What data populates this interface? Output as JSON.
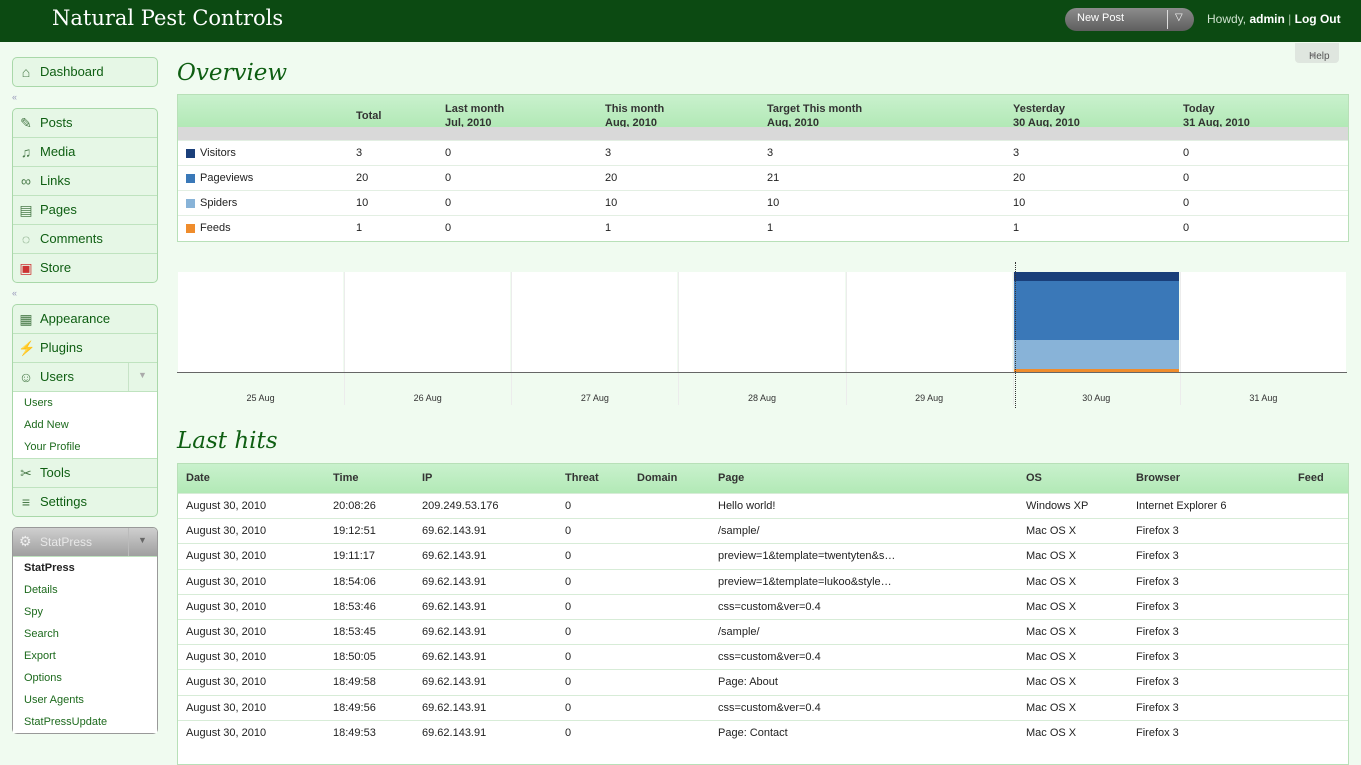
{
  "header": {
    "site_title": "Natural Pest Controls",
    "new_post": "New Post",
    "howdy_prefix": "Howdy,",
    "user": "admin",
    "logout": "Log Out",
    "help": "Help"
  },
  "sidebar": {
    "group1": [
      {
        "label": "Dashboard",
        "icon": "house-icon"
      }
    ],
    "group2": [
      {
        "label": "Posts",
        "icon": "pin-icon"
      },
      {
        "label": "Media",
        "icon": "media-icon"
      },
      {
        "label": "Links",
        "icon": "link-icon"
      },
      {
        "label": "Pages",
        "icon": "pages-icon"
      },
      {
        "label": "Comments",
        "icon": "comment-icon"
      },
      {
        "label": "Store",
        "icon": "store-icon"
      }
    ],
    "group3": [
      {
        "label": "Appearance",
        "icon": "appearance-icon"
      },
      {
        "label": "Plugins",
        "icon": "plugin-icon"
      },
      {
        "label": "Users",
        "icon": "users-icon"
      }
    ],
    "users_submenu": [
      "Users",
      "Add New",
      "Your Profile"
    ],
    "group3b": [
      {
        "label": "Tools",
        "icon": "tools-icon"
      },
      {
        "label": "Settings",
        "icon": "settings-icon"
      }
    ],
    "statpress": {
      "label": "StatPress",
      "items": [
        "StatPress",
        "Details",
        "Spy",
        "Search",
        "Export",
        "Options",
        "User Agents",
        "StatPressUpdate"
      ]
    }
  },
  "overview": {
    "title": "Overview",
    "columns": [
      {
        "l1": "Total",
        "l2": ""
      },
      {
        "l1": "Last month",
        "l2": "Jul, 2010"
      },
      {
        "l1": "This month",
        "l2": "Aug, 2010"
      },
      {
        "l1": "Target This month",
        "l2": "Aug, 2010"
      },
      {
        "l1": "Yesterday",
        "l2": "30 Aug, 2010"
      },
      {
        "l1": "Today",
        "l2": "31 Aug, 2010"
      }
    ],
    "rows": [
      {
        "label": "Visitors",
        "color": "#1a3f7a",
        "values": [
          "3",
          "0",
          "3",
          "3",
          "3",
          "0"
        ]
      },
      {
        "label": "Pageviews",
        "color": "#3a78b8",
        "values": [
          "20",
          "0",
          "20",
          "21",
          "20",
          "0"
        ]
      },
      {
        "label": "Spiders",
        "color": "#88b3d8",
        "values": [
          "10",
          "0",
          "10",
          "10",
          "10",
          "0"
        ]
      },
      {
        "label": "Feeds",
        "color": "#ef8c2c",
        "values": [
          "1",
          "0",
          "1",
          "1",
          "1",
          "0"
        ]
      }
    ]
  },
  "chart_data": {
    "type": "bar",
    "categories": [
      "25 Aug",
      "26 Aug",
      "27 Aug",
      "28 Aug",
      "29 Aug",
      "30 Aug",
      "31 Aug"
    ],
    "stacked": true,
    "series": [
      {
        "name": "Feeds",
        "color": "#ef8c2c",
        "values": [
          0,
          0,
          0,
          0,
          0,
          1,
          0
        ]
      },
      {
        "name": "Spiders",
        "color": "#88b3d8",
        "values": [
          0,
          0,
          0,
          0,
          0,
          10,
          0
        ]
      },
      {
        "name": "Pageviews",
        "color": "#3a78b8",
        "values": [
          0,
          0,
          0,
          0,
          0,
          20,
          0
        ]
      },
      {
        "name": "Visitors",
        "color": "#1a3f7a",
        "values": [
          0,
          0,
          0,
          0,
          0,
          3,
          0
        ]
      }
    ],
    "ylim": [
      0,
      34
    ],
    "highlight_category": "30 Aug"
  },
  "last_hits": {
    "title": "Last hits",
    "columns": [
      "Date",
      "Time",
      "IP",
      "Threat",
      "Domain",
      "Page",
      "OS",
      "Browser",
      "Feed"
    ],
    "rows": [
      [
        "August 30, 2010",
        "20:08:26",
        "209.249.53.176",
        "0",
        "",
        "Hello world!",
        "Windows XP",
        "Internet Explorer 6",
        ""
      ],
      [
        "August 30, 2010",
        "19:12:51",
        "69.62.143.91",
        "0",
        "",
        "/sample/",
        "Mac OS X",
        "Firefox 3",
        ""
      ],
      [
        "August 30, 2010",
        "19:11:17",
        "69.62.143.91",
        "0",
        "",
        "preview=1&template=twentyten&s…",
        "Mac OS X",
        "Firefox 3",
        ""
      ],
      [
        "August 30, 2010",
        "18:54:06",
        "69.62.143.91",
        "0",
        "",
        "preview=1&template=lukoo&style…",
        "Mac OS X",
        "Firefox 3",
        ""
      ],
      [
        "August 30, 2010",
        "18:53:46",
        "69.62.143.91",
        "0",
        "",
        "css=custom&ver=0.4",
        "Mac OS X",
        "Firefox 3",
        ""
      ],
      [
        "August 30, 2010",
        "18:53:45",
        "69.62.143.91",
        "0",
        "",
        "/sample/",
        "Mac OS X",
        "Firefox 3",
        ""
      ],
      [
        "August 30, 2010",
        "18:50:05",
        "69.62.143.91",
        "0",
        "",
        "css=custom&ver=0.4",
        "Mac OS X",
        "Firefox 3",
        ""
      ],
      [
        "August 30, 2010",
        "18:49:58",
        "69.62.143.91",
        "0",
        "",
        "Page: About",
        "Mac OS X",
        "Firefox 3",
        ""
      ],
      [
        "August 30, 2010",
        "18:49:56",
        "69.62.143.91",
        "0",
        "",
        "css=custom&ver=0.4",
        "Mac OS X",
        "Firefox 3",
        ""
      ],
      [
        "August 30, 2010",
        "18:49:53",
        "69.62.143.91",
        "0",
        "",
        "Page: Contact",
        "Mac OS X",
        "Firefox 3",
        ""
      ]
    ]
  }
}
